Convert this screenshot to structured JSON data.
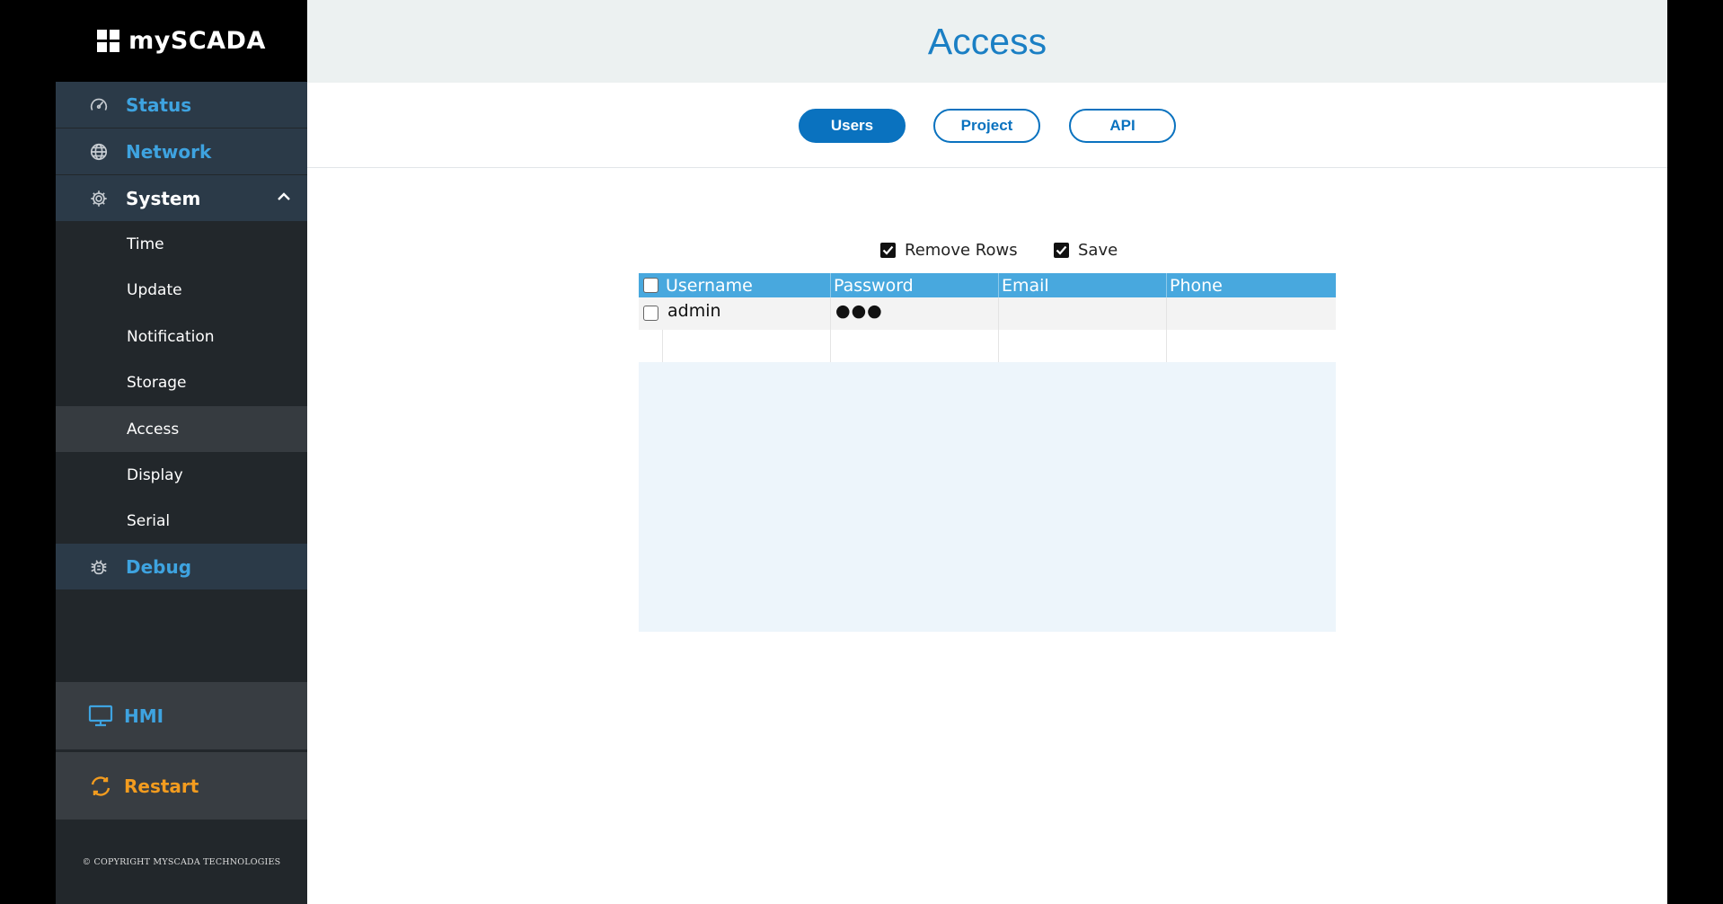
{
  "app": {
    "logo_text": "mySCADA"
  },
  "sidebar": {
    "main_items": [
      {
        "label": "Status",
        "icon": "gauge-icon"
      },
      {
        "label": "Network",
        "icon": "globe-icon"
      },
      {
        "label": "System",
        "icon": "gear-icon",
        "expanded": true
      }
    ],
    "system_subitems": [
      "Time",
      "Update",
      "Notification",
      "Storage",
      "Access",
      "Display",
      "Serial"
    ],
    "selected_subitem": "Access",
    "debug": {
      "label": "Debug",
      "icon": "bug-icon"
    },
    "hmi": {
      "label": "HMI",
      "icon": "monitor-icon"
    },
    "restart": {
      "label": "Restart",
      "icon": "refresh-icon"
    },
    "copyright": "© COPYRIGHT MYSCADA TECHNOLOGIES"
  },
  "main": {
    "title": "Access",
    "tabs": [
      {
        "label": "Users",
        "active": true
      },
      {
        "label": "Project",
        "active": false
      },
      {
        "label": "API",
        "active": false
      }
    ],
    "options": [
      {
        "label": "Remove Rows",
        "checked": true
      },
      {
        "label": "Save",
        "checked": true
      }
    ],
    "table": {
      "columns": [
        "Username",
        "Password",
        "Email",
        "Phone"
      ],
      "rows": [
        {
          "username": "admin",
          "password": "●●●",
          "email": "",
          "phone": ""
        }
      ]
    }
  },
  "colors": {
    "accent_blue": "#1a7fc4",
    "tab_blue": "#0a72bf",
    "header_blue": "#48a8de",
    "sidebar_link": "#3ea3e0",
    "restart_orange": "#f39c1f"
  }
}
